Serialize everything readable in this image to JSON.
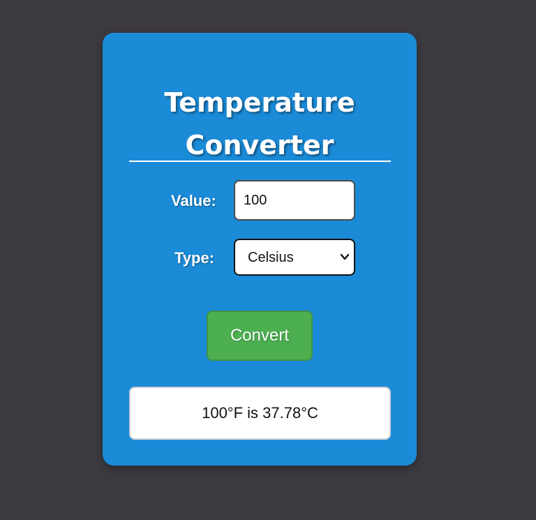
{
  "converter": {
    "title_line1": "Temperature",
    "title_line2": "Converter",
    "value_label": "Value:",
    "value_input": "100",
    "type_label": "Type:",
    "type_selected": "Celsius",
    "convert_label": "Convert",
    "result_text": "100°F is 37.78°C"
  },
  "colors": {
    "background": "#3d3b40",
    "card": "#1b8bd8",
    "button": "#4caf50",
    "text_light": "#ffffff"
  },
  "icons": {
    "select_arrow": "chevron-down-icon"
  }
}
